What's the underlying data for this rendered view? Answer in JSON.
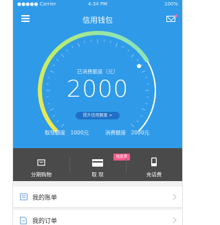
{
  "status_bar": {
    "carrier": "●●●●● Carrier",
    "time": "4:34 PM",
    "battery": "100%"
  },
  "nav": {
    "title": "信用钱包",
    "menu_icon": "menu-icon",
    "mail_icon": "mail-icon"
  },
  "gauge": {
    "label": "已消费额度（元）",
    "value": "2000",
    "fill_fraction": 0.72,
    "upgrade_button": "提升信用额度 >"
  },
  "limits": {
    "cash_limit": "取现额度　1000元",
    "spend_limit": "消费额度　2000元"
  },
  "actions": [
    {
      "label": "分期购物",
      "icon": "shopping-bag-icon"
    },
    {
      "label": "取 现",
      "icon": "card-icon",
      "badge": "信息签"
    },
    {
      "label": "充话费",
      "icon": "phone-icon"
    }
  ],
  "list": [
    {
      "label": "我的账单",
      "icon": "bill-icon"
    },
    {
      "label": "我的订单",
      "icon": "order-icon"
    }
  ],
  "colors": {
    "header": "#2f9ae8",
    "action_bar": "#4a4a4a",
    "arc_start": "#f5e84a",
    "arc_end": "#7fe0d0",
    "badge": "#ff5a8c"
  }
}
